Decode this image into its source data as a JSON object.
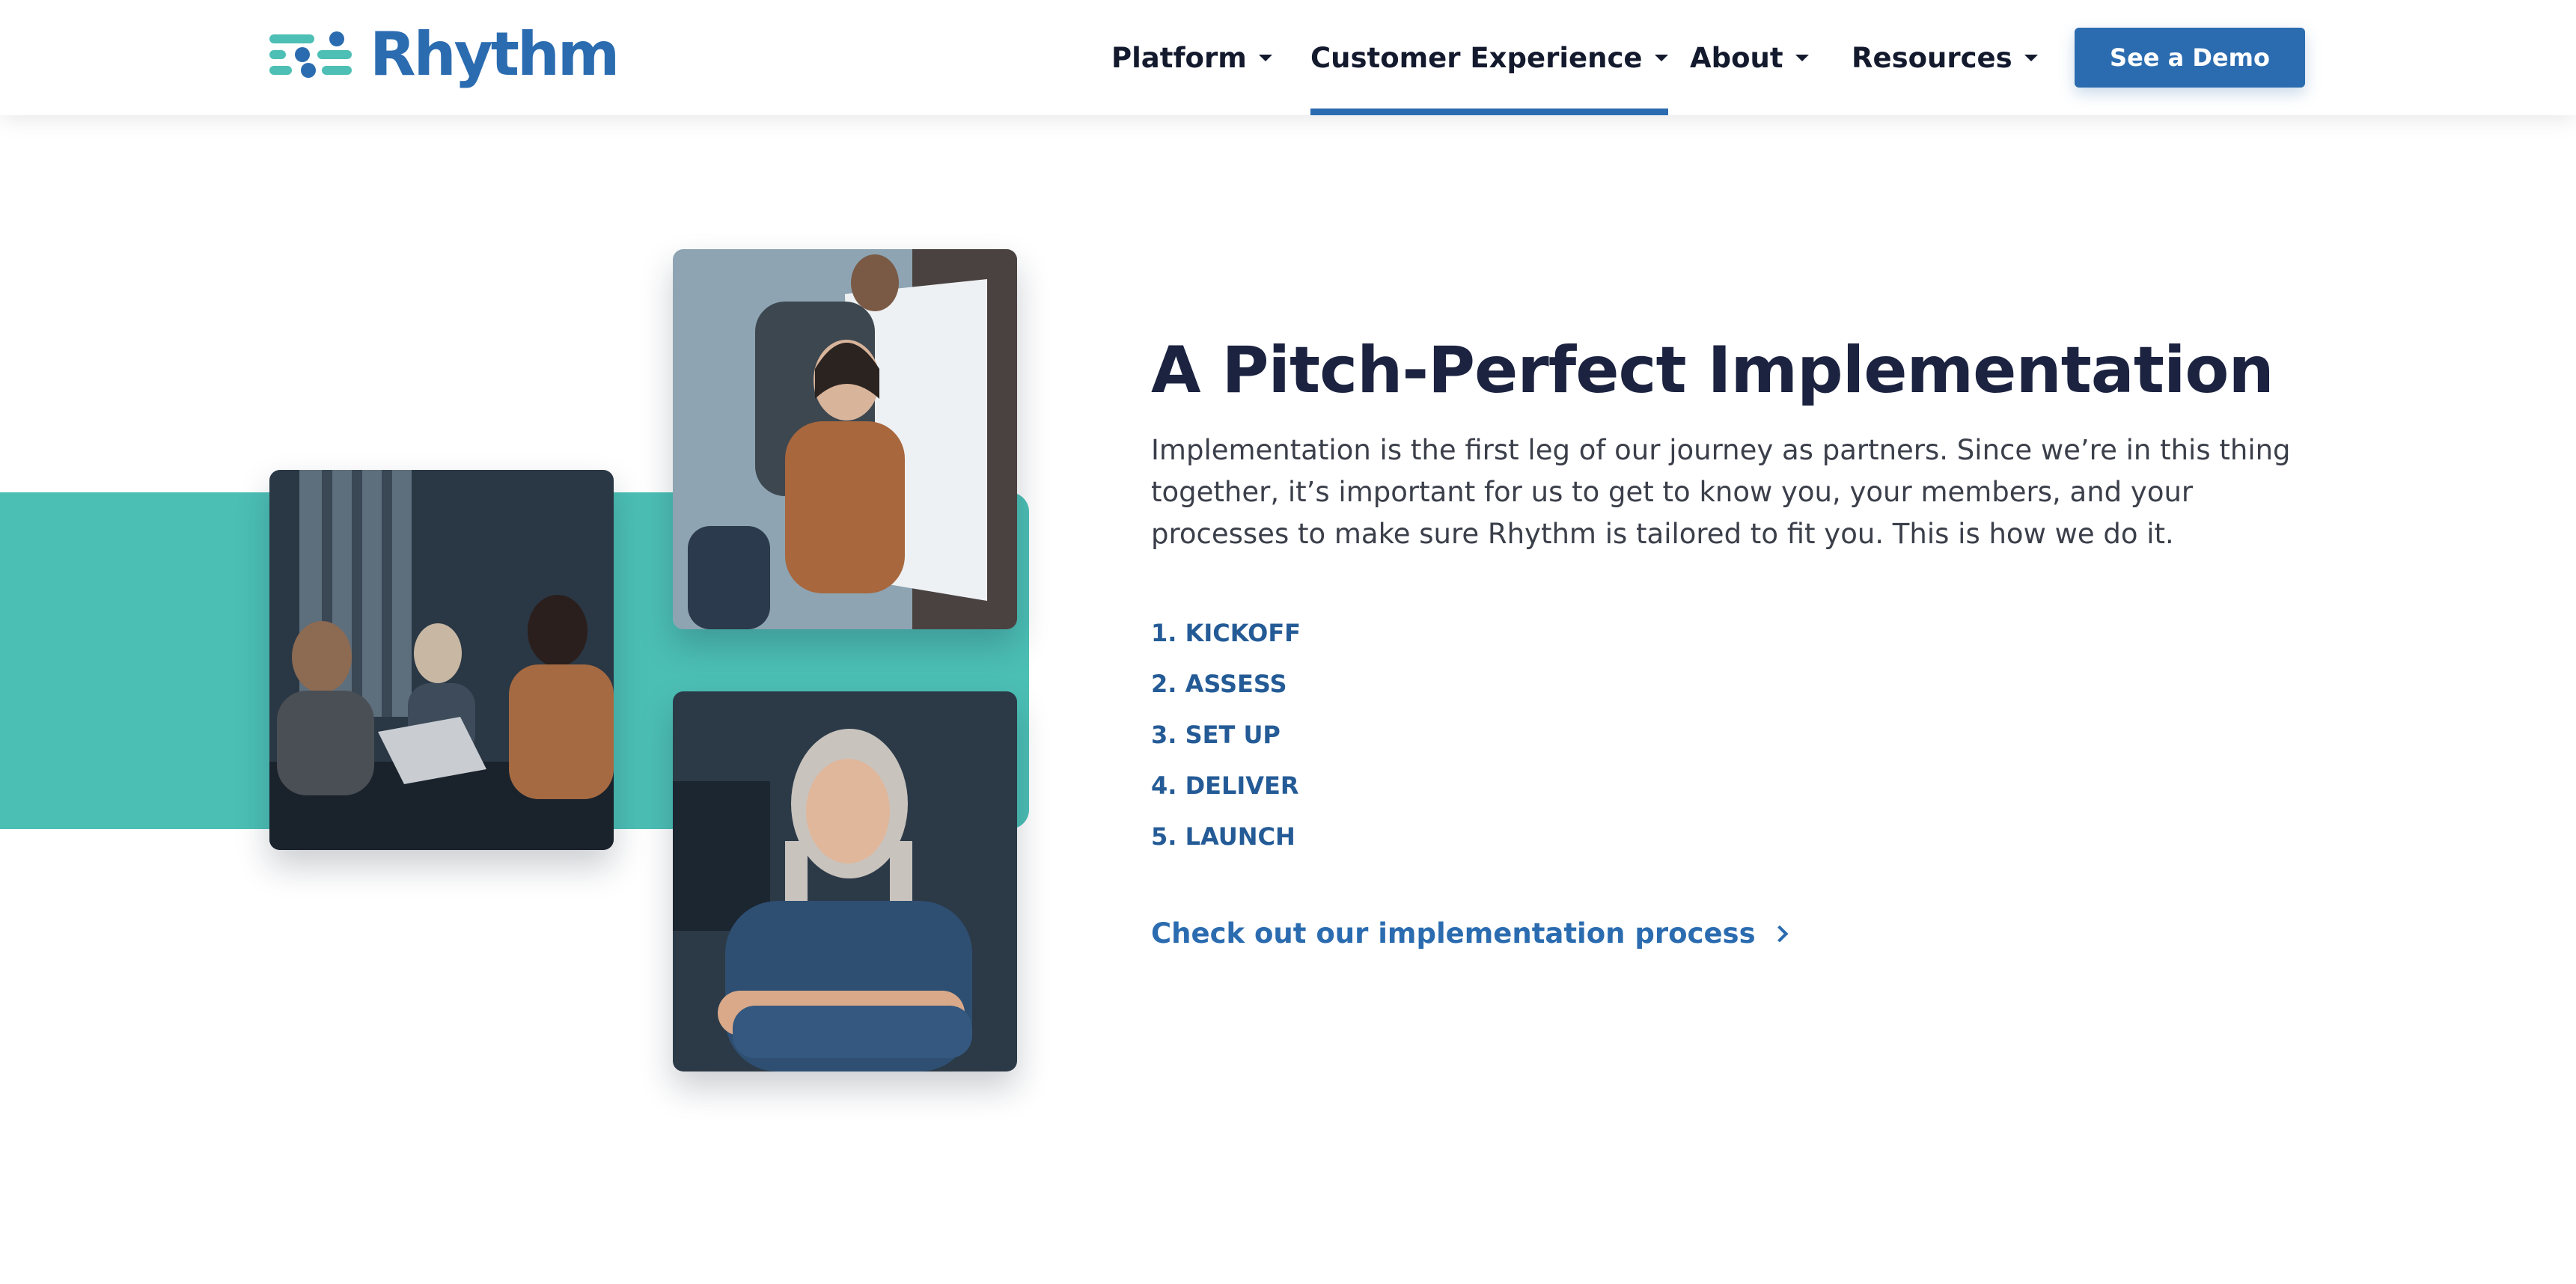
{
  "brand": {
    "name": "Rhythm"
  },
  "nav": {
    "items": [
      {
        "label": "Platform"
      },
      {
        "label": "Customer Experience",
        "active": true
      },
      {
        "label": "About"
      },
      {
        "label": "Resources"
      }
    ],
    "cta_label": "See a Demo"
  },
  "section": {
    "headline": "A Pitch-Perfect Implementation",
    "body": "Implementation is the first leg of our journey as partners. Since we’re in this thing together, it’s important for us to get to know you, your members, and your processes to make sure Rhythm is tailored to fit you. This is how we do it.",
    "steps": [
      "1. KICKOFF",
      "2. ASSESS",
      "3. SET UP",
      "4. DELIVER",
      "5. LAUNCH"
    ],
    "link_label": "Check out our implementation process"
  },
  "colors": {
    "brand_blue": "#2b6cb0",
    "teal": "#4cbfb5",
    "heading": "#1c2340"
  }
}
